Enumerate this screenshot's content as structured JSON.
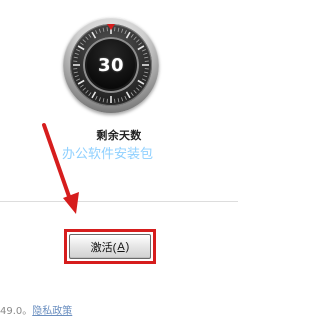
{
  "countdown": {
    "value": "30",
    "label": "剩余天数"
  },
  "watermark": {
    "text": "办公软件安装包"
  },
  "activation": {
    "button_prefix": "激活(",
    "button_key": "A",
    "button_suffix": ")"
  },
  "footer": {
    "version_text": "49.0。",
    "privacy_link": "隐私政策"
  },
  "colors": {
    "highlight": "#d61d1d",
    "watermark": "#8fd0ff",
    "link": "#6b8fc0"
  },
  "icons": {
    "arrow": "arrow-icon"
  }
}
